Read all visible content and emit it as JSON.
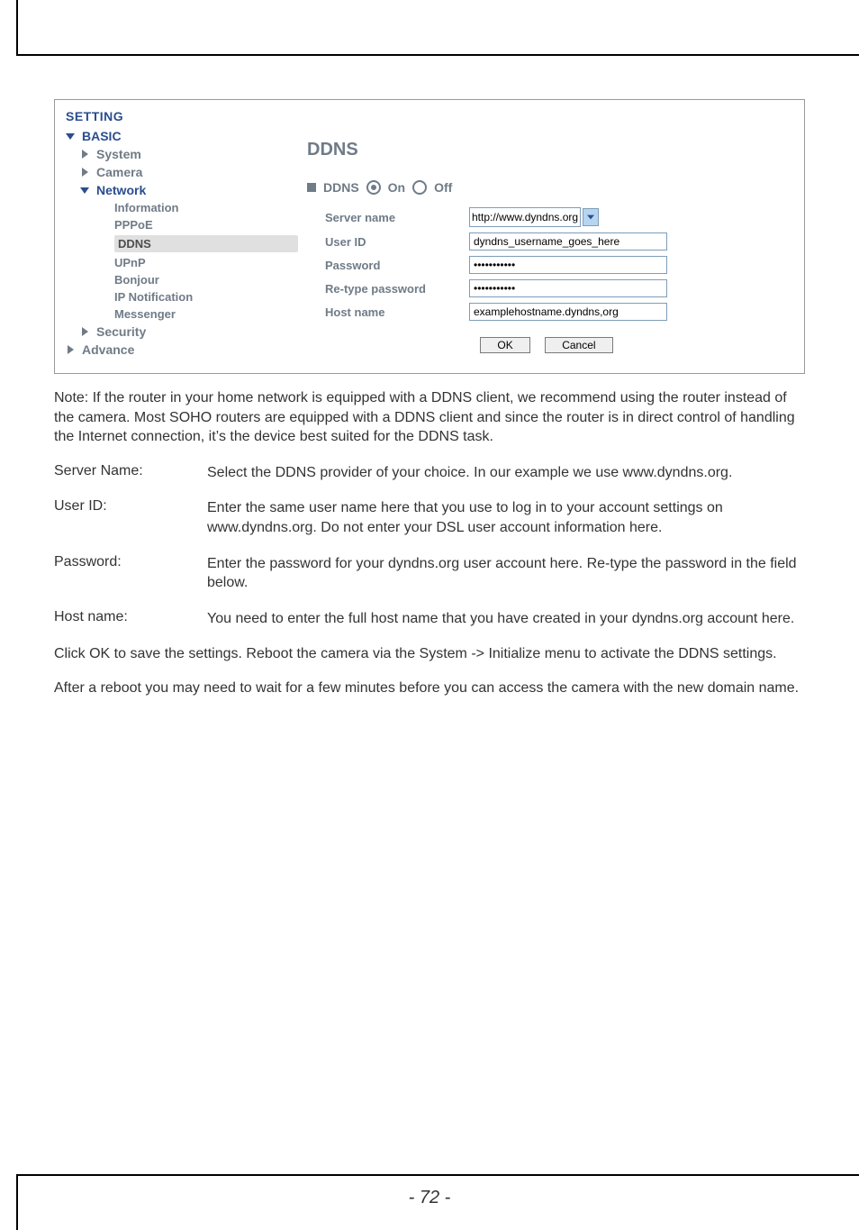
{
  "sidebar": {
    "heading": "SETTING",
    "basic": "BASIC",
    "system": "System",
    "camera": "Camera",
    "network": "Network",
    "subs": {
      "information": "Information",
      "pppoe": "PPPoE",
      "ddns": "DDNS",
      "upnp": "UPnP",
      "bonjour": "Bonjour",
      "ipnotif": "IP Notification",
      "messenger": "Messenger"
    },
    "security": "Security",
    "advance": "Advance"
  },
  "form": {
    "title": "DDNS",
    "legend": "DDNS",
    "on": "On",
    "off": "Off",
    "server_name_label": "Server name",
    "server_name_value": "http://www.dyndns.org",
    "user_id_label": "User ID",
    "user_id_value": "dyndns_username_goes_here",
    "password_label": "Password",
    "password_value": "•••••••••••",
    "retype_label": "Re-type password",
    "retype_value": "•••••••••••",
    "host_label": "Host name",
    "host_value": "examplehostname.dyndns,org",
    "ok": "OK",
    "cancel": "Cancel"
  },
  "text": {
    "note": "Note: If the router in your home network is equipped with a DDNS client, we recommend using the router instead of the camera. Most SOHO routers are equipped with a DDNS client and since the router is in direct control of handling the Internet connection, it’s the device best suited for the DDNS task.",
    "defs": {
      "server_name_k": "Server Name:",
      "server_name_v": "Select the DDNS provider of your choice. In our example we use www.dyndns.org.",
      "user_id_k": "User ID:",
      "user_id_v": "Enter the same user name here that you use to log in to your account settings on www.dyndns.org. Do not enter your DSL user account information here.",
      "password_k": "Password:",
      "password_v": "Enter the password for your dyndns.org user account here. Re-type the password in the field below.",
      "host_k": "Host name:",
      "host_v": "You need to enter the full host name that you have created in your dyndns.org account here."
    },
    "p1": "Click OK to save the settings. Reboot the camera via the System -> Initialize menu to activate the DDNS settings.",
    "p2": "After a reboot you may need to wait for a few minutes before you can access the camera with the new domain name.",
    "page": "- 72 -"
  }
}
